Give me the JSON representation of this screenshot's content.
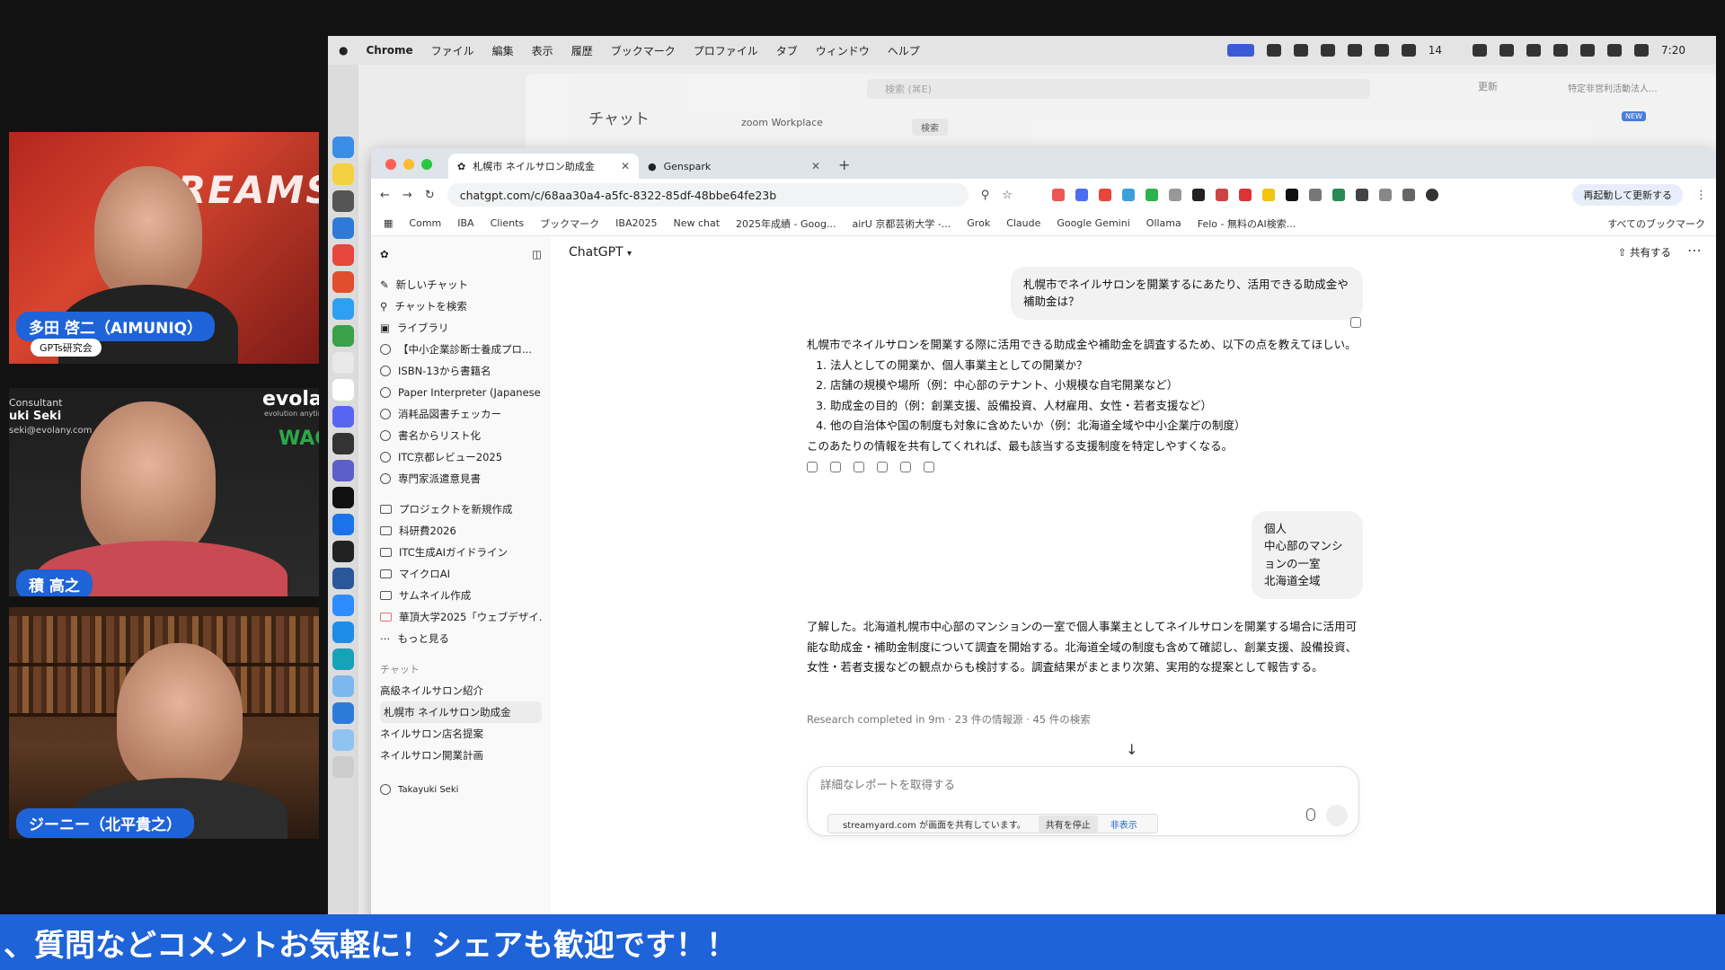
{
  "participants": [
    {
      "name": "多田 啓二（AIMUNIQ）",
      "sub": "GPTs研究会",
      "bg_text": "DREAMS"
    },
    {
      "name": "積 高之",
      "overlay_left": "Consultant",
      "overlay_name": "uki Seki",
      "overlay_email": "seki@evolany.com",
      "brand": "evolar",
      "brand_sub": "evolution anytime",
      "badge": "WAC"
    },
    {
      "name": "ジーニー（北平貴之）"
    }
  ],
  "mac_menu": [
    "Chrome",
    "ファイル",
    "編集",
    "表示",
    "履歴",
    "ブックマーク",
    "プロファイル",
    "タブ",
    "ウィンドウ",
    "ヘルプ"
  ],
  "status_bar": {
    "badge_count": "14",
    "time": "7:20"
  },
  "zoom_window": {
    "title": "チャット",
    "search": "検索 (⌘E)",
    "update": "更新",
    "org": "特定非営利活動法人...",
    "brand": "zoom Workplace",
    "search2": "検索",
    "new_badge": "NEW"
  },
  "browser": {
    "tabs": [
      {
        "label": "札幌市 ネイルサロン助成金",
        "active": true
      },
      {
        "label": "Genspark",
        "active": false
      }
    ],
    "url": "chatgpt.com/c/68aa30a4-a5fc-8322-85df-48bbe64fe23b",
    "relaunch": "再起動して更新する",
    "bookmarks": [
      "Comm",
      "IBA",
      "Clients",
      "ブックマーク",
      "IBA2025",
      "New chat",
      "2025年成績 - Goog...",
      "airU 京都芸術大学 -...",
      "Grok",
      "Claude",
      "Google Gemini",
      "Ollama",
      "Felo - 無料のAI検索...",
      "すべてのブックマーク"
    ]
  },
  "sidebar": {
    "top": [
      "新しいチャット",
      "チャットを検索",
      "ライブラリ"
    ],
    "gpts": [
      "【中小企業診断士養成プロ...",
      "ISBN-13から書籍名",
      "Paper Interpreter (Japanese)",
      "消耗品図書チェッカー",
      "書名からリスト化",
      "ITC京都レビュー2025",
      "専門家派遣意見書"
    ],
    "projects": [
      "プロジェクトを新規作成",
      "科研費2026",
      "ITC生成AIガイドライン",
      "マイクロAI",
      "サムネイル作成",
      "華頂大学2025「ウェブデザイ..."
    ],
    "more": "もっと見る",
    "chats_label": "チャット",
    "chats": [
      "高級ネイルサロン紹介",
      "札幌市 ネイルサロン助成金",
      "ネイルサロン店名提案",
      "ネイルサロン開業計画"
    ],
    "user": "Takayuki Seki"
  },
  "chat": {
    "model": "ChatGPT",
    "share": "共有する",
    "user_msg_1": "札幌市でネイルサロンを開業するにあたり、活用できる助成金や補助金は？",
    "assistant_intro": "札幌市でネイルサロンを開業する際に活用できる助成金や補助金を調査するため、以下の点を教えてほしい。",
    "assistant_list": [
      "法人としての開業か、個人事業主としての開業か？",
      "店舗の規模や場所（例：中心部のテナント、小規模な自宅開業など）",
      "助成金の目的（例：創業支援、設備投資、人材雇用、女性・若者支援など）",
      "他の自治体や国の制度も対象に含めたいか（例：北海道全域や中小企業庁の制度）"
    ],
    "assistant_outro": "このあたりの情報を共有してくれれば、最も該当する支援制度を特定しやすくなる。",
    "user_msg_2": [
      "個人",
      "中心部のマンションの一室",
      "北海道全域"
    ],
    "assistant_reply_2": "了解した。北海道札幌市中心部のマンションの一室で個人事業主としてネイルサロンを開業する場合に活用可能な助成金・補助金制度について調査を開始する。北海道全域の制度も含めて確認し、創業支援、設備投資、女性・若者支援などの観点からも検討する。調査結果がまとまり次第、実用的な提案として報告する。",
    "research_status": "Research completed in 9m · 23 件の情報源 · 45 件の検索",
    "composer_placeholder": "詳細なレポートを取得する",
    "screenshare_notice": "streamyard.com が画面を共有しています。",
    "stop_share": "共有を停止",
    "hide": "非表示"
  },
  "ticker": "、質問などコメントお気軽に！シェアも歓迎です！！"
}
